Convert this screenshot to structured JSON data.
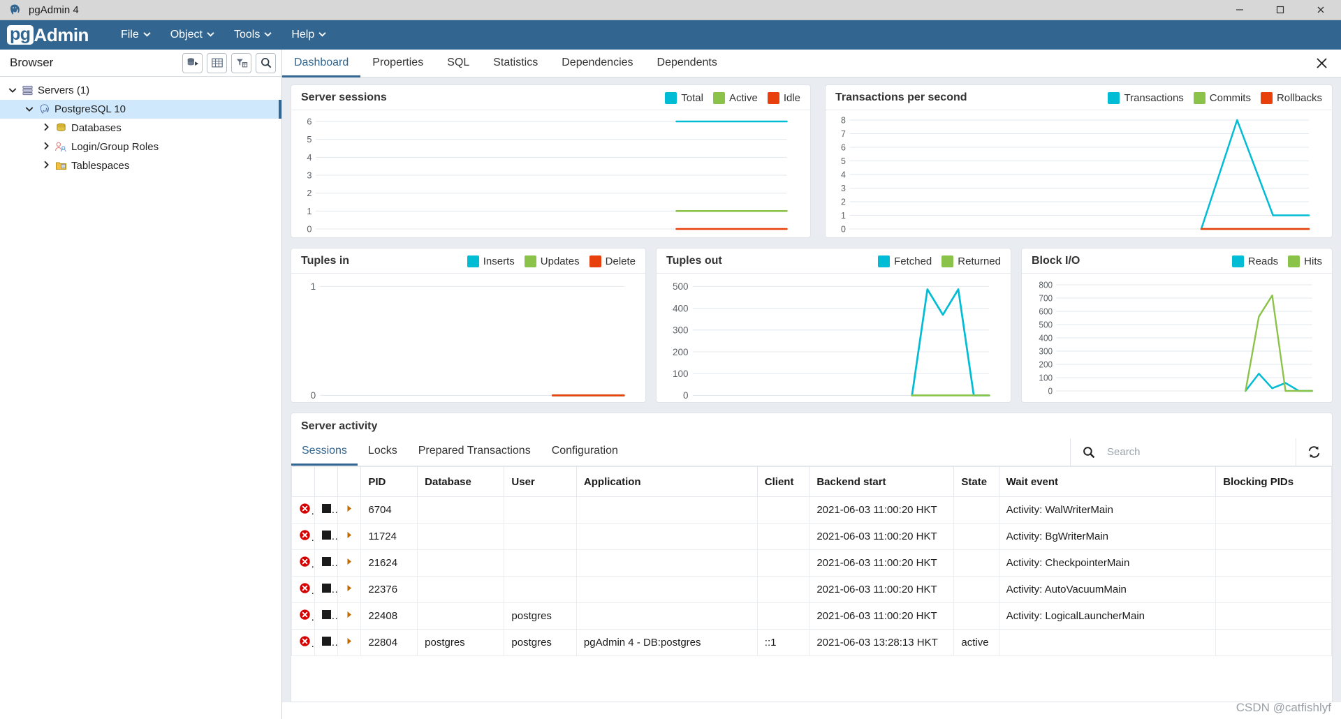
{
  "window": {
    "title": "pgAdmin 4",
    "icon": "postgres-elephant-icon",
    "minimize": "–",
    "maximize": "❐",
    "close": "✕"
  },
  "menubar": {
    "logo_pg": "pg",
    "logo_admin": "Admin",
    "items": [
      {
        "label": "File",
        "caret": "⌄"
      },
      {
        "label": "Object",
        "caret": "⌄"
      },
      {
        "label": "Tools",
        "caret": "⌄"
      },
      {
        "label": "Help",
        "caret": "⌄"
      }
    ]
  },
  "browser": {
    "title": "Browser",
    "tools": [
      "object-explorer-icon",
      "grid-icon",
      "filter-icon",
      "search-icon"
    ],
    "tree": [
      {
        "label": "Servers (1)",
        "level": 1,
        "arrow": "⌄",
        "icon": "servers-icon",
        "selected": false
      },
      {
        "label": "PostgreSQL 10",
        "level": 2,
        "arrow": "⌄",
        "icon": "postgres-icon",
        "selected": true
      },
      {
        "label": "Databases",
        "level": 3,
        "arrow": "›",
        "icon": "database-icon",
        "selected": false
      },
      {
        "label": "Login/Group Roles",
        "level": 3,
        "arrow": "›",
        "icon": "roles-icon",
        "selected": false
      },
      {
        "label": "Tablespaces",
        "level": 3,
        "arrow": "›",
        "icon": "tablespace-icon",
        "selected": false
      }
    ]
  },
  "tabs": {
    "items": [
      "Dashboard",
      "Properties",
      "SQL",
      "Statistics",
      "Dependencies",
      "Dependents"
    ],
    "active": "Dashboard",
    "close_label": "✕"
  },
  "colors": {
    "cyan": "#00bcd4",
    "green": "#8bc34a",
    "orange": "#e8400c",
    "accent": "#326690",
    "grid": "#e3e8ee"
  },
  "chart_data": [
    {
      "type": "line",
      "title": "Server sessions",
      "xlabel": "",
      "ylabel": "",
      "ylim": [
        0,
        6
      ],
      "yticks": [
        0,
        1,
        2,
        3,
        4,
        5,
        6
      ],
      "grid": true,
      "legend_position": "top-right",
      "series": [
        {
          "name": "Total",
          "color": "#00bcd4",
          "values": [
            6,
            6,
            6,
            6
          ]
        },
        {
          "name": "Active",
          "color": "#8bc34a",
          "values": [
            1,
            1,
            1,
            1
          ]
        },
        {
          "name": "Idle",
          "color": "#e8400c",
          "values": [
            0,
            0,
            0,
            0
          ]
        }
      ]
    },
    {
      "type": "line",
      "title": "Transactions per second",
      "xlabel": "",
      "ylabel": "",
      "ylim": [
        0,
        8
      ],
      "yticks": [
        0,
        1,
        2,
        3,
        4,
        5,
        6,
        7,
        8
      ],
      "grid": true,
      "legend_position": "top-right",
      "series": [
        {
          "name": "Transactions",
          "color": "#00bcd4",
          "values": [
            0,
            8,
            1,
            1
          ]
        },
        {
          "name": "Commits",
          "color": "#8bc34a",
          "values": [
            0,
            0,
            0,
            0
          ]
        },
        {
          "name": "Rollbacks",
          "color": "#e8400c",
          "values": [
            0,
            0,
            0,
            0
          ]
        }
      ]
    },
    {
      "type": "line",
      "title": "Tuples in",
      "xlabel": "",
      "ylabel": "",
      "ylim": [
        0,
        1
      ],
      "yticks": [
        0,
        1
      ],
      "grid": true,
      "legend_position": "top-right",
      "series": [
        {
          "name": "Inserts",
          "color": "#00bcd4",
          "values": [
            0,
            0,
            0,
            0
          ]
        },
        {
          "name": "Updates",
          "color": "#8bc34a",
          "values": [
            0,
            0,
            0,
            0
          ]
        },
        {
          "name": "Delete",
          "color": "#e8400c",
          "values": [
            0,
            0,
            0,
            0
          ]
        }
      ]
    },
    {
      "type": "line",
      "title": "Tuples out",
      "xlabel": "",
      "ylabel": "",
      "ylim": [
        0,
        500
      ],
      "yticks": [
        0,
        100,
        200,
        300,
        400,
        500
      ],
      "grid": true,
      "legend_position": "top-right",
      "series": [
        {
          "name": "Fetched",
          "color": "#00bcd4",
          "values": [
            0,
            487,
            370,
            487,
            0,
            0
          ]
        },
        {
          "name": "Returned",
          "color": "#8bc34a",
          "values": [
            0,
            0,
            0,
            0,
            0,
            0
          ]
        }
      ]
    },
    {
      "type": "line",
      "title": "Block I/O",
      "xlabel": "",
      "ylabel": "",
      "ylim": [
        0,
        800
      ],
      "yticks": [
        0,
        100,
        200,
        300,
        400,
        500,
        600,
        700,
        800
      ],
      "grid": true,
      "legend_position": "top-right",
      "series": [
        {
          "name": "Reads",
          "color": "#00bcd4",
          "values": [
            0,
            130,
            20,
            60,
            0,
            0
          ]
        },
        {
          "name": "Hits",
          "color": "#8bc34a",
          "values": [
            0,
            560,
            720,
            0,
            0,
            0
          ]
        }
      ]
    }
  ],
  "activity": {
    "title": "Server activity",
    "tabs": [
      "Sessions",
      "Locks",
      "Prepared Transactions",
      "Configuration"
    ],
    "active_tab": "Sessions",
    "search": {
      "placeholder": "Search",
      "value": ""
    },
    "refresh_label": "refresh-icon",
    "columns": [
      "",
      "",
      "",
      "PID",
      "Database",
      "User",
      "Application",
      "Client",
      "Backend start",
      "State",
      "Wait event",
      "Blocking PIDs"
    ],
    "rows": [
      {
        "pid": "6704",
        "database": "",
        "user": "",
        "application": "",
        "client": "",
        "backend_start": "2021-06-03 11:00:20 HKT",
        "state": "",
        "wait_event": "Activity: WalWriterMain",
        "blocking_pids": ""
      },
      {
        "pid": "11724",
        "database": "",
        "user": "",
        "application": "",
        "client": "",
        "backend_start": "2021-06-03 11:00:20 HKT",
        "state": "",
        "wait_event": "Activity: BgWriterMain",
        "blocking_pids": ""
      },
      {
        "pid": "21624",
        "database": "",
        "user": "",
        "application": "",
        "client": "",
        "backend_start": "2021-06-03 11:00:20 HKT",
        "state": "",
        "wait_event": "Activity: CheckpointerMain",
        "blocking_pids": ""
      },
      {
        "pid": "22376",
        "database": "",
        "user": "",
        "application": "",
        "client": "",
        "backend_start": "2021-06-03 11:00:20 HKT",
        "state": "",
        "wait_event": "Activity: AutoVacuumMain",
        "blocking_pids": ""
      },
      {
        "pid": "22408",
        "database": "",
        "user": "postgres",
        "application": "",
        "client": "",
        "backend_start": "2021-06-03 11:00:20 HKT",
        "state": "",
        "wait_event": "Activity: LogicalLauncherMain",
        "blocking_pids": ""
      },
      {
        "pid": "22804",
        "database": "postgres",
        "user": "postgres",
        "application": "pgAdmin 4 - DB:postgres",
        "client": "::1",
        "backend_start": "2021-06-03 13:28:13 HKT",
        "state": "active",
        "wait_event": "",
        "blocking_pids": ""
      }
    ]
  },
  "watermark": "CSDN @catfishlyf"
}
